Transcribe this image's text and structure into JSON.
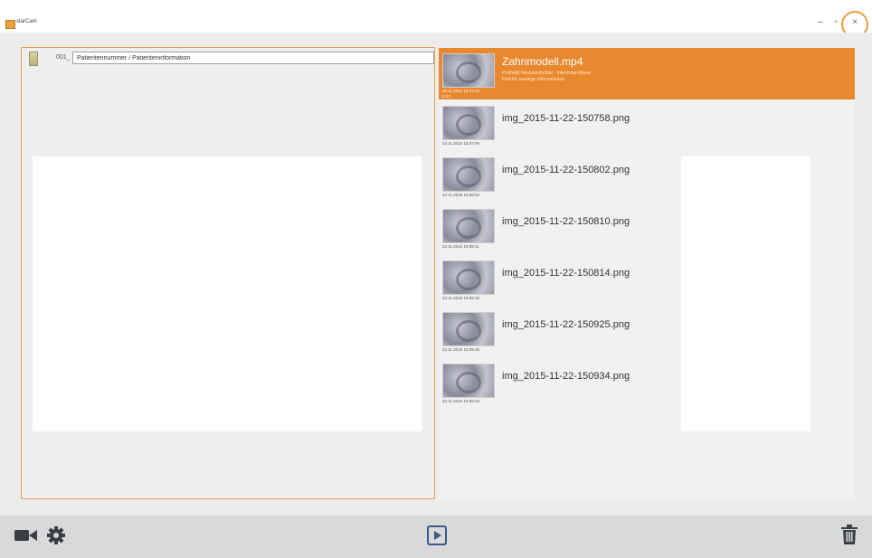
{
  "window": {
    "title": "starCam"
  },
  "window_controls": {
    "minimize": "–",
    "maximize": "▫",
    "close": "×"
  },
  "patient": {
    "number": "001_",
    "info_value": "Patientennummer / Patienteninformation"
  },
  "media": [
    {
      "name": "Zahnmodell.mp4",
      "date": "22.11.2015 15:07:04",
      "duration": "0:27",
      "desc1": "Prothetik herausnehmbar - Interimsprothese",
      "desc2": "Feld für sonstige Informationen",
      "selected": true
    },
    {
      "name": "img_2015-11-22-150758.png",
      "date": "22.11.2015 15:07:59"
    },
    {
      "name": "img_2015-11-22-150802.png",
      "date": "22.11.2015 15:08:02"
    },
    {
      "name": "img_2015-11-22-150810.png",
      "date": "22.11.2015 15:08:11"
    },
    {
      "name": "img_2015-11-22-150814.png",
      "date": "22.11.2015 15:08:15"
    },
    {
      "name": "img_2015-11-22-150925.png",
      "date": "22.11.2015 15:09:25"
    },
    {
      "name": "img_2015-11-22-150934.png",
      "date": "22.11.2015 15:09:34"
    }
  ],
  "toolbar": {
    "left_icons": [
      "video-camera-icon",
      "gear-icon"
    ],
    "center_icon": "play-icon",
    "right_icon": "trash-icon"
  },
  "colors": {
    "accent": "#e9892f",
    "panel_border": "#e6a24a",
    "toolbar": "#d9d9d9"
  }
}
